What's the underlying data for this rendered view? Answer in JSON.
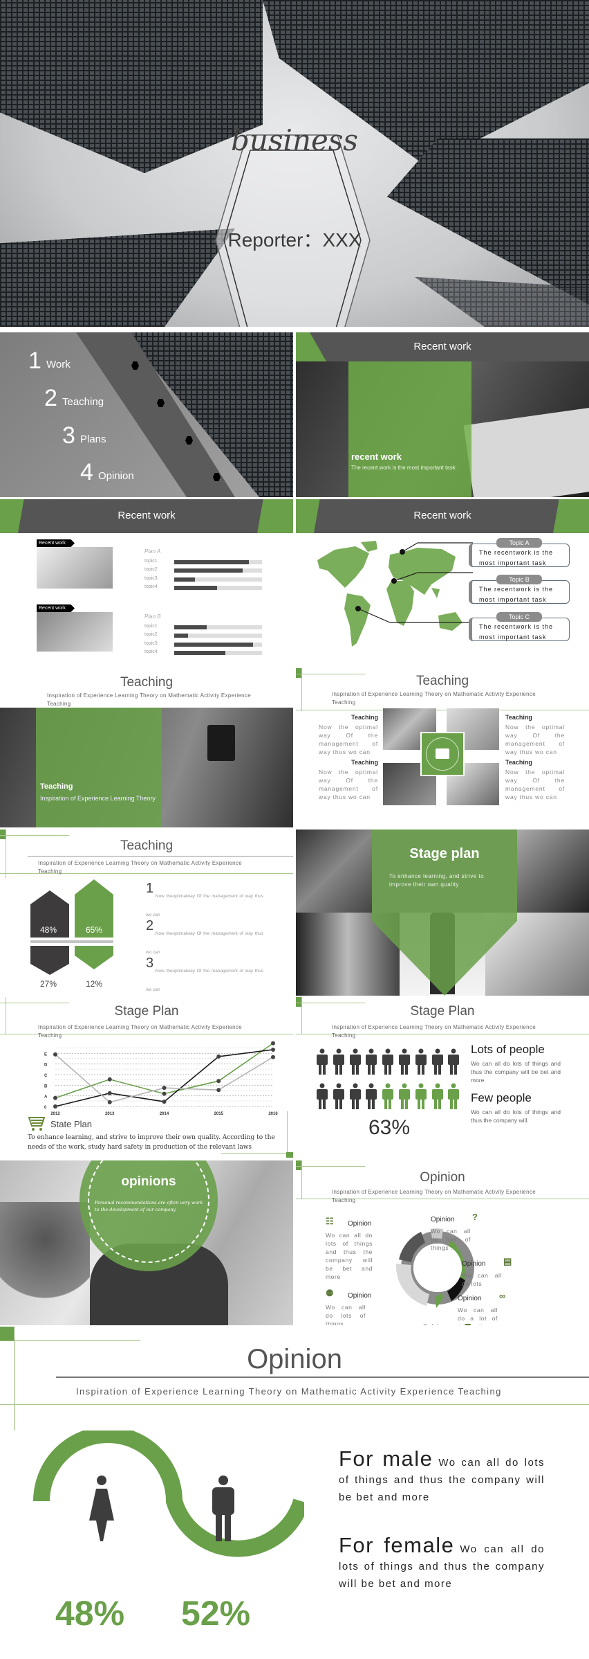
{
  "colors": {
    "accent": "#6aa04a",
    "dark": "#454545",
    "header": "#555555"
  },
  "cover": {
    "title": "business",
    "reporter": "Reporter：XXX"
  },
  "toc": {
    "items": [
      {
        "num": "1",
        "label": "Work"
      },
      {
        "num": "2",
        "label": "Teaching"
      },
      {
        "num": "3",
        "label": "Plans"
      },
      {
        "num": "4",
        "label": "Opinion"
      }
    ]
  },
  "recent_photo": {
    "header": "Recent work",
    "heading": "recent work",
    "desc": "The recent work is the most important task"
  },
  "recent_bars": {
    "header": "Recent work",
    "blocks": [
      {
        "tag": "Recent work",
        "plan": "Plan A",
        "topics": [
          {
            "label": "topic1",
            "value": 0.85
          },
          {
            "label": "topic2",
            "value": 0.78
          },
          {
            "label": "topic3",
            "value": 0.24
          },
          {
            "label": "topic4",
            "value": 0.49
          }
        ]
      },
      {
        "tag": "Recent work",
        "plan": "Plan B",
        "topics": [
          {
            "label": "topic1",
            "value": 0.37
          },
          {
            "label": "topic2",
            "value": 0.16
          },
          {
            "label": "topic3",
            "value": 0.9
          },
          {
            "label": "topic4",
            "value": 0.58
          }
        ]
      }
    ]
  },
  "recent_map": {
    "header": "Recent work",
    "topics": [
      {
        "tab": "Topic A",
        "text": "The recentwork is the most important task"
      },
      {
        "tab": "Topic B",
        "text": "The recentwork is the most important task"
      },
      {
        "tab": "Topic C",
        "text": "The recentwork is the most important task"
      }
    ]
  },
  "subtitle": "Inspiration of Experience Learning Theory on Mathematic Activity Experience Teaching",
  "teaching_photo": {
    "title": "Teaching",
    "heading": "Teaching",
    "desc": "Inspiration of Experience Learning Theory"
  },
  "teaching_grid": {
    "title": "Teaching",
    "blocks": [
      {
        "heading": "Teaching",
        "text": "Now the optimal way Of the management of way thus wo can"
      },
      {
        "heading": "Teaching",
        "text": "Now the optimal way Of the management of way thus wo can"
      },
      {
        "heading": "Teaching",
        "text": "Now the optimal way Of the management of way thus wo can"
      },
      {
        "heading": "Teaching",
        "text": "Now the optimal way Of the management of way thus wo can"
      }
    ]
  },
  "teaching_hex": {
    "title": "Teaching",
    "values": [
      "48%",
      "65%",
      "27%",
      "12%"
    ],
    "items": [
      {
        "num": "1",
        "text": ".Now theoptimalway Of the management of way thus wo can"
      },
      {
        "num": "2",
        "text": ".Now theoptimalway Of the management of way thus wo can"
      },
      {
        "num": "3",
        "text": ".Now theoptimalway Of the management of way thus wo can"
      }
    ]
  },
  "stage_photo": {
    "title": "Stage plan",
    "desc": "To enhance learning, and strive to improve their own quality"
  },
  "stage_chart": {
    "title": "Stage Plan",
    "caption": "State Plan",
    "paragraph": "To enhance learning, and strive to improve their own quality. According to the needs of the work, study hard safety in production of the relevant laws"
  },
  "chart_data": {
    "type": "line",
    "x": [
      "2012",
      "2013",
      "2014",
      "2015",
      "2016"
    ],
    "y_tick_labels": [
      "0",
      "A",
      "B",
      "C",
      "D",
      "E"
    ],
    "ylim": [
      0,
      6
    ],
    "grid": true,
    "series": [
      {
        "color": "#6aa04a",
        "values": [
          0.8,
          2.55,
          1.2,
          2.4,
          5.95
        ]
      },
      {
        "color": "#1a1a1a",
        "values": [
          0,
          1.25,
          0.45,
          4.7,
          5.35
        ]
      },
      {
        "color": "#b5b5b5",
        "values": [
          4.9,
          0.4,
          1.75,
          1.55,
          4.65
        ]
      }
    ]
  },
  "people": {
    "title": "Stage Plan",
    "total": 18,
    "green": 5,
    "percent": "63%",
    "lots_title": "Lots of people",
    "lots_text": "Wo can all do lots of things and thus the company will be bet and more.",
    "few_title": "Few people",
    "few_text": "Wo can all do lots of things and thus the company will."
  },
  "opinions_photo": {
    "title": "opinions",
    "desc": "Personal recommendations are often very work to the development of our company"
  },
  "opinion_donut": {
    "title": "Opinion",
    "labels": [
      {
        "title": "Opinion",
        "text": "Wo can all do lots of things and thus the company will be bet and more",
        "icon": "rss-icon"
      },
      {
        "title": "Opinion",
        "text": "Wo can all do lots of things .",
        "icon": "question-icon"
      },
      {
        "title": "Opinion",
        "text": "Wo can all do lots",
        "icon": "briefcase-icon"
      },
      {
        "title": "Opinion",
        "text": "Wo can all do a lot of things thus a lot",
        "icon": "glasses-icon"
      },
      {
        "title": "Opinion",
        "text": "",
        "icon": "folder-icon"
      },
      {
        "title": "Opinion",
        "text": "Wo can all do lots of things",
        "icon": "users-icon"
      }
    ]
  },
  "final": {
    "title": "Opinion",
    "male_title": "For male",
    "male_text": "Wo can all do lots of things and thus the company will be bet and more",
    "female_title": "For female",
    "female_text": "Wo can all do lots of things and thus the company will be bet and more",
    "pct_female": "48%",
    "pct_male": "52%"
  }
}
